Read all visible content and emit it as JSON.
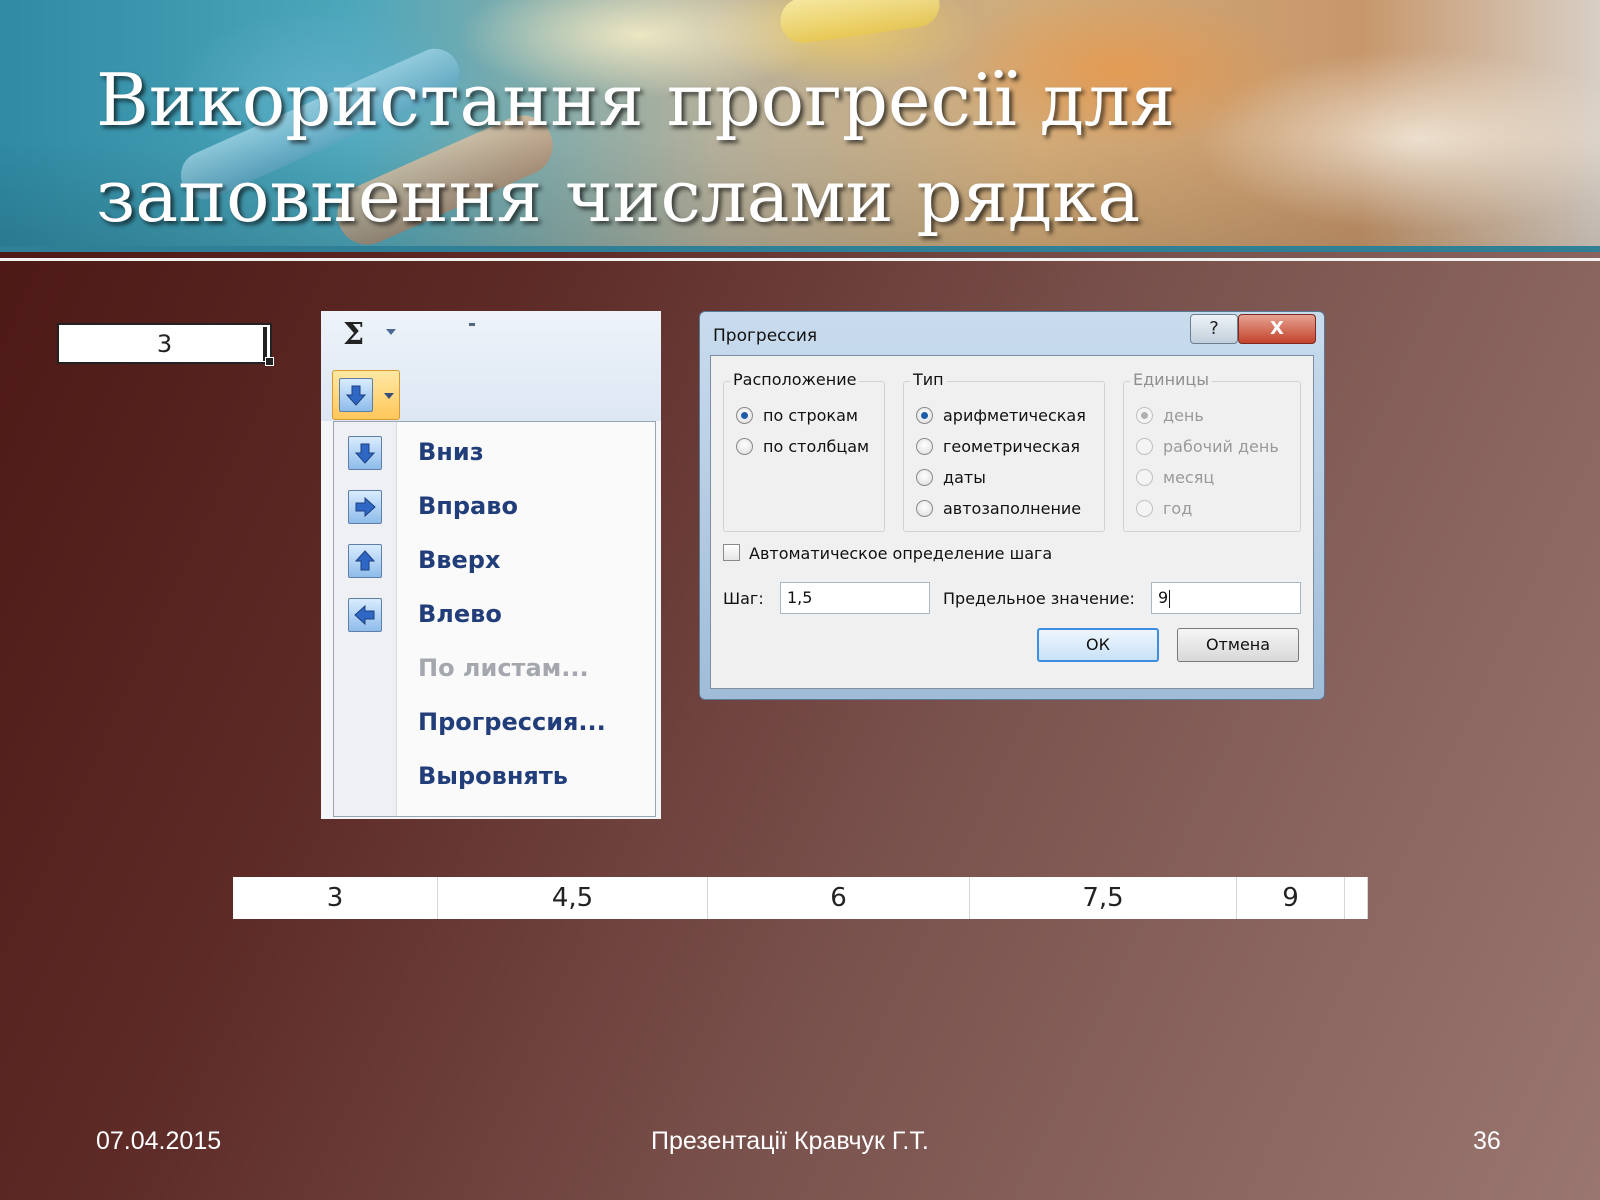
{
  "slide": {
    "title_line1": "Використання прогресії для",
    "title_line2": "заповнення числами рядка"
  },
  "start_cell": {
    "value": "3"
  },
  "fill_menu": {
    "ribbon_sum_symbol": "Σ",
    "items": [
      {
        "label": "Вниз",
        "icon": "arrow-down-icon",
        "enabled": true
      },
      {
        "label": "Вправо",
        "icon": "arrow-right-icon",
        "enabled": true
      },
      {
        "label": "Вверх",
        "icon": "arrow-up-icon",
        "enabled": true
      },
      {
        "label": "Влево",
        "icon": "arrow-left-icon",
        "enabled": true
      },
      {
        "label": "По листам...",
        "enabled": false
      },
      {
        "label": "Прогрессия...",
        "enabled": true
      },
      {
        "label": "Выровнять",
        "enabled": true
      }
    ]
  },
  "dialog": {
    "title": "Прогрессия",
    "help_label": "?",
    "close_label": "X",
    "location": {
      "title": "Расположение",
      "options": [
        "по строкам",
        "по столбцам"
      ],
      "selected": 0
    },
    "type": {
      "title": "Тип",
      "options": [
        "арифметическая",
        "геометрическая",
        "даты",
        "автозаполнение"
      ],
      "selected": 0
    },
    "units": {
      "title": "Единицы",
      "options": [
        "день",
        "рабочий день",
        "месяц",
        "год"
      ],
      "selected": 0,
      "enabled": false
    },
    "auto_step_label": "Автоматическое определение шага",
    "auto_step_checked": false,
    "step_label": "Шаг:",
    "step_value": "1,5",
    "limit_label": "Предельное значение:",
    "limit_value": "9",
    "ok_label": "ОК",
    "cancel_label": "Отмена"
  },
  "result_row": {
    "values": [
      "3",
      "4,5",
      "6",
      "7,5",
      "9",
      ""
    ]
  },
  "footer": {
    "date": "07.04.2015",
    "author": "Презентації Кравчук Г.Т.",
    "page": "36"
  }
}
